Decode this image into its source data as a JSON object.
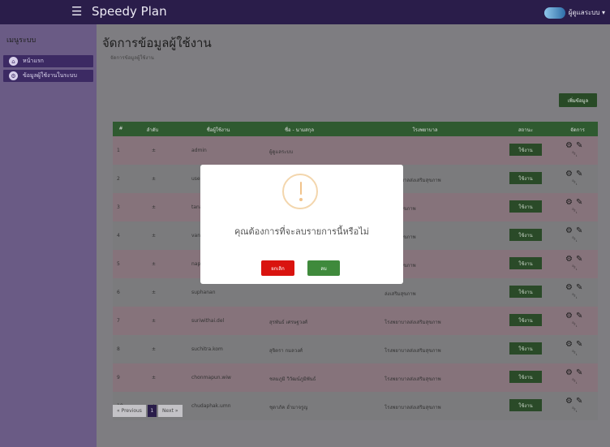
{
  "topbar": {
    "menu_icon": "hamburger-icon",
    "brand": "Speedy Plan",
    "user_name": "ผู้ดูแลระบบ ▾"
  },
  "sidebar": {
    "heading": "เมนูระบบ",
    "items": [
      {
        "label": "หน้าแรก",
        "icon": "home-icon"
      },
      {
        "label": "ข้อมูลผู้ใช้งานในระบบ",
        "icon": "users-cog-icon"
      }
    ]
  },
  "page": {
    "title": "จัดการข้อมูลผู้ใช้งาน",
    "breadcrumb": "จัดการข้อมูลผู้ใช้งาน",
    "add_button": "เพิ่มข้อมูล"
  },
  "table": {
    "headers": [
      "#",
      "ลำดับ",
      "ชื่อผู้ใช้งาน",
      "ชื่อ - นามสกุล",
      "โรงพยาบาล",
      "สถานะ",
      "จัดการ"
    ],
    "rows": [
      {
        "num": "1",
        "order": "±",
        "username": "admin",
        "fullname": "ผู้ดูแลระบบ",
        "hospital": "",
        "status": "ใช้งาน"
      },
      {
        "num": "2",
        "order": "±",
        "username": "user1",
        "fullname": "สมชาย เจริญพัฒนา",
        "hospital": "โรงพยาบาลส่งเสริมสุขภาพ",
        "status": "ใช้งาน"
      },
      {
        "num": "3",
        "order": "±",
        "username": "tanasit.wi",
        "fullname": "",
        "hospital": "ล่งเสริมสุขภาพ",
        "status": "ใช้งาน"
      },
      {
        "num": "4",
        "order": "±",
        "username": "vannee.pe",
        "fullname": "",
        "hospital": "ล่งเสริมสุขภาพ",
        "status": "ใช้งาน"
      },
      {
        "num": "5",
        "order": "±",
        "username": "napaporn",
        "fullname": "",
        "hospital": "ล่งเสริมสุขภาพ",
        "status": "ใช้งาน"
      },
      {
        "num": "6",
        "order": "±",
        "username": "suphanan",
        "fullname": "",
        "hospital": "ล่งเสริมสุขภาพ",
        "status": "ใช้งาน"
      },
      {
        "num": "7",
        "order": "±",
        "username": "suriwithai.del",
        "fullname": "สุรพันธ์ เศรษฐวงศ์",
        "hospital": "โรงพยาบาลส่งเสริมสุขภาพ",
        "status": "ใช้งาน"
      },
      {
        "num": "8",
        "order": "±",
        "username": "suchitra.kom",
        "fullname": "สุจิตรา กมลวงศ์",
        "hospital": "โรงพยาบาลส่งเสริมสุขภาพ",
        "status": "ใช้งาน"
      },
      {
        "num": "9",
        "order": "±",
        "username": "chonmapun.wiw",
        "fullname": "ชลมภูมิ วิวัฒน์ภูมิพันธ์",
        "hospital": "โรงพยาบาลส่งเสริมสุขภาพ",
        "status": "ใช้งาน"
      },
      {
        "num": "10",
        "order": "±",
        "username": "chudaphak.umn",
        "fullname": "ชุดาภัค อ่ำมาจรูญ",
        "hospital": "โรงพยาบาลส่งเสริมสุขภาพ",
        "status": "ใช้งาน"
      }
    ]
  },
  "pagination": {
    "prev": "« Previous",
    "current": "1",
    "next": "Next »"
  },
  "modal": {
    "icon": "warning-icon",
    "message": "คุณต้องการที่จะลบรายการนี้หรือไม่",
    "cancel_label": "ยกเลิก",
    "confirm_label": "ลบ"
  },
  "colors": {
    "topbar": "#2a1d4a",
    "sidebar": "#6a5b85",
    "table_header": "#2f5a30",
    "status_badge": "#2a4a28",
    "cancel": "#d9130f",
    "confirm": "#3f8a3c"
  }
}
